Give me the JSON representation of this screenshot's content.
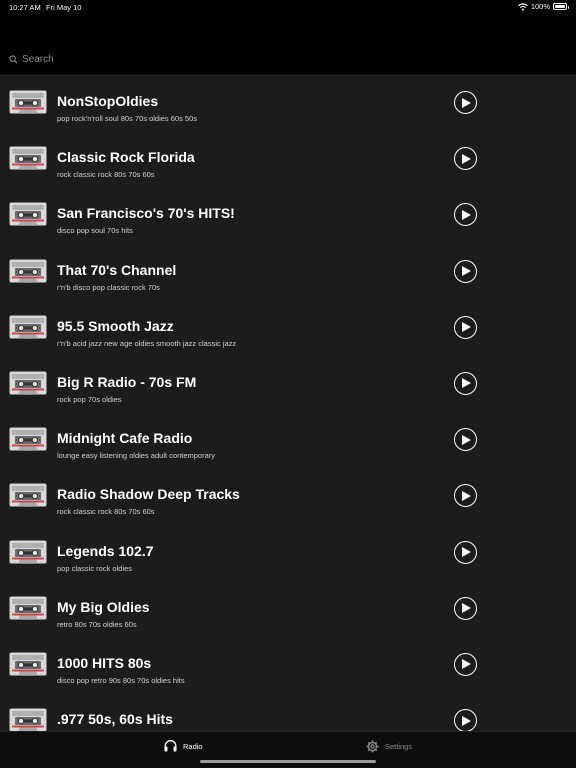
{
  "status_bar": {
    "time": "10:27 AM",
    "date": "Fri May 10",
    "battery": "100%"
  },
  "search": {
    "placeholder": "Search"
  },
  "stations": [
    {
      "title": "NonStopOldies",
      "tags": "pop rock'n'roll soul 80s 70s oldies 60s 50s"
    },
    {
      "title": "Classic Rock Florida",
      "tags": "rock classic rock 80s 70s 60s"
    },
    {
      "title": "San Francisco's 70's HITS!",
      "tags": "disco pop soul 70s hits"
    },
    {
      "title": "That 70's Channel",
      "tags": "r'n'b disco pop classic rock 70s"
    },
    {
      "title": "95.5 Smooth Jazz",
      "tags": "r'n'b acid jazz new age oldies smooth jazz classic jazz"
    },
    {
      "title": "Big R Radio - 70s FM",
      "tags": "rock pop 70s oldies"
    },
    {
      "title": "Midnight Cafe Radio",
      "tags": "lounge easy listening oldies adult contemporary"
    },
    {
      "title": "Radio Shadow Deep Tracks",
      "tags": "rock classic rock 80s 70s 60s"
    },
    {
      "title": "Legends 102.7",
      "tags": "pop classic rock oldies"
    },
    {
      "title": "My Big Oldies",
      "tags": "retro 80s 70s oldies 60s"
    },
    {
      "title": "1000 HITS 80s",
      "tags": "disco pop retro 90s 80s 70s oldies hits"
    },
    {
      "title": ".977 50s, 60s Hits",
      "tags": ""
    }
  ],
  "tabs": {
    "radio": "Radio",
    "settings": "Settings"
  },
  "colors": {
    "background": "#000000",
    "list_background": "#1c1c1c",
    "active_tab": "#ffffff",
    "inactive_tab": "#8a8a8a"
  },
  "icons": {
    "cassette": "cassette-tape-icon",
    "play": "play-icon",
    "radio_tab": "headphones-icon",
    "settings_tab": "gear-icon",
    "search": "search-icon"
  }
}
